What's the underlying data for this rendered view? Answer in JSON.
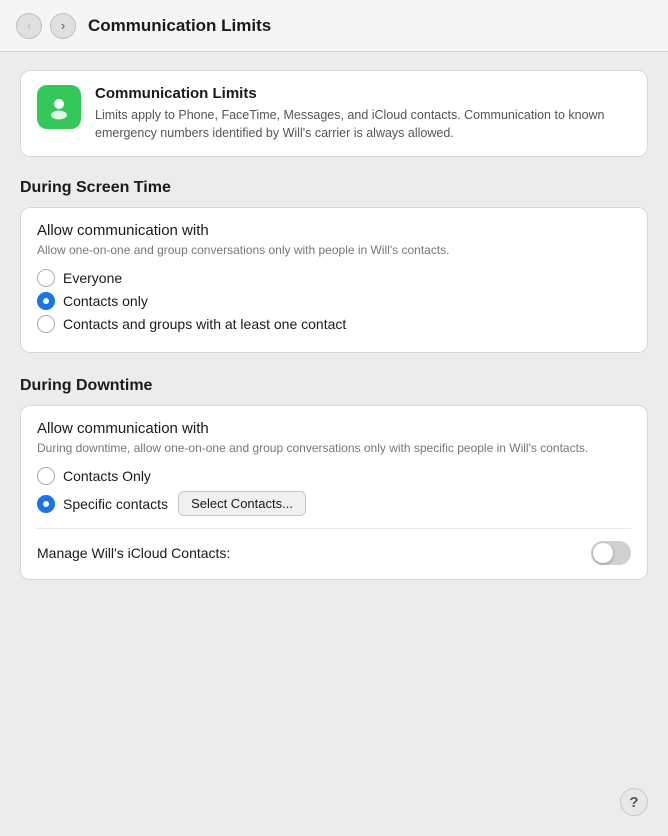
{
  "topbar": {
    "title": "Communication Limits",
    "back_label": "‹",
    "forward_label": "›"
  },
  "infoCard": {
    "title": "Communication Limits",
    "description": "Limits apply to Phone, FaceTime, Messages, and iCloud contacts. Communication to known emergency numbers identified by Will's carrier is always allowed."
  },
  "screenTime": {
    "sectionHeader": "During Screen Time",
    "cardTitle": "Allow communication with",
    "cardDesc": "Allow one-on-one and group conversations only with people in Will's contacts.",
    "options": [
      {
        "id": "st-everyone",
        "label": "Everyone",
        "selected": false
      },
      {
        "id": "st-contacts-only",
        "label": "Contacts only",
        "selected": true
      },
      {
        "id": "st-contacts-groups",
        "label": "Contacts and groups with at least one contact",
        "selected": false
      }
    ]
  },
  "downtime": {
    "sectionHeader": "During Downtime",
    "cardTitle": "Allow communication with",
    "cardDesc": "During downtime, allow one-on-one and group conversations only with specific people in Will's contacts.",
    "options": [
      {
        "id": "dt-contacts-only",
        "label": "Contacts Only",
        "selected": false
      },
      {
        "id": "dt-specific",
        "label": "Specific contacts",
        "selected": true
      }
    ],
    "selectContactsBtn": "Select Contacts...",
    "toggleLabel": "Manage Will's iCloud Contacts:",
    "toggleOn": false
  },
  "helpBtn": "?"
}
